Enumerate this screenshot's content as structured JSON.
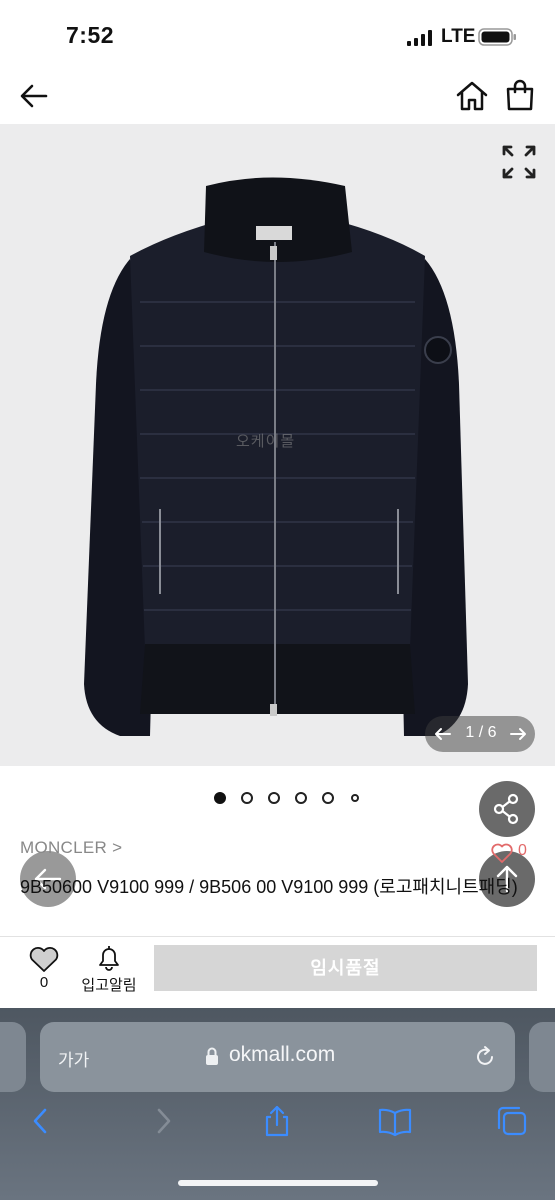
{
  "status_bar": {
    "time": "7:52",
    "network": "LTE"
  },
  "top_nav": {
    "back_icon": "arrow-left-icon",
    "home_icon": "home-icon",
    "cart_icon": "shopping-bag-icon"
  },
  "product_image": {
    "watermark": "오케이몰",
    "pager_text": "1 / 6",
    "current_page": 1,
    "total_pages": 6,
    "dots_count": 6
  },
  "product": {
    "brand": "MONCLER >",
    "like_count": "0",
    "title": "9B50600 V9100 999 / 9B506 00 V9100 999 (로고패치니트패딩)"
  },
  "action_bar": {
    "wish_count": "0",
    "notify_label": "입고알림",
    "soldout_label": "임시품절"
  },
  "browser": {
    "aa_label": "가가",
    "url": "okmall.com"
  },
  "colors": {
    "image_bg": "#ececed",
    "like_red": "#e26a6a",
    "soldout_bg": "#d6d6d6",
    "safari_bar": "#5a6470",
    "toolbar_icons": "#3b8cff"
  }
}
